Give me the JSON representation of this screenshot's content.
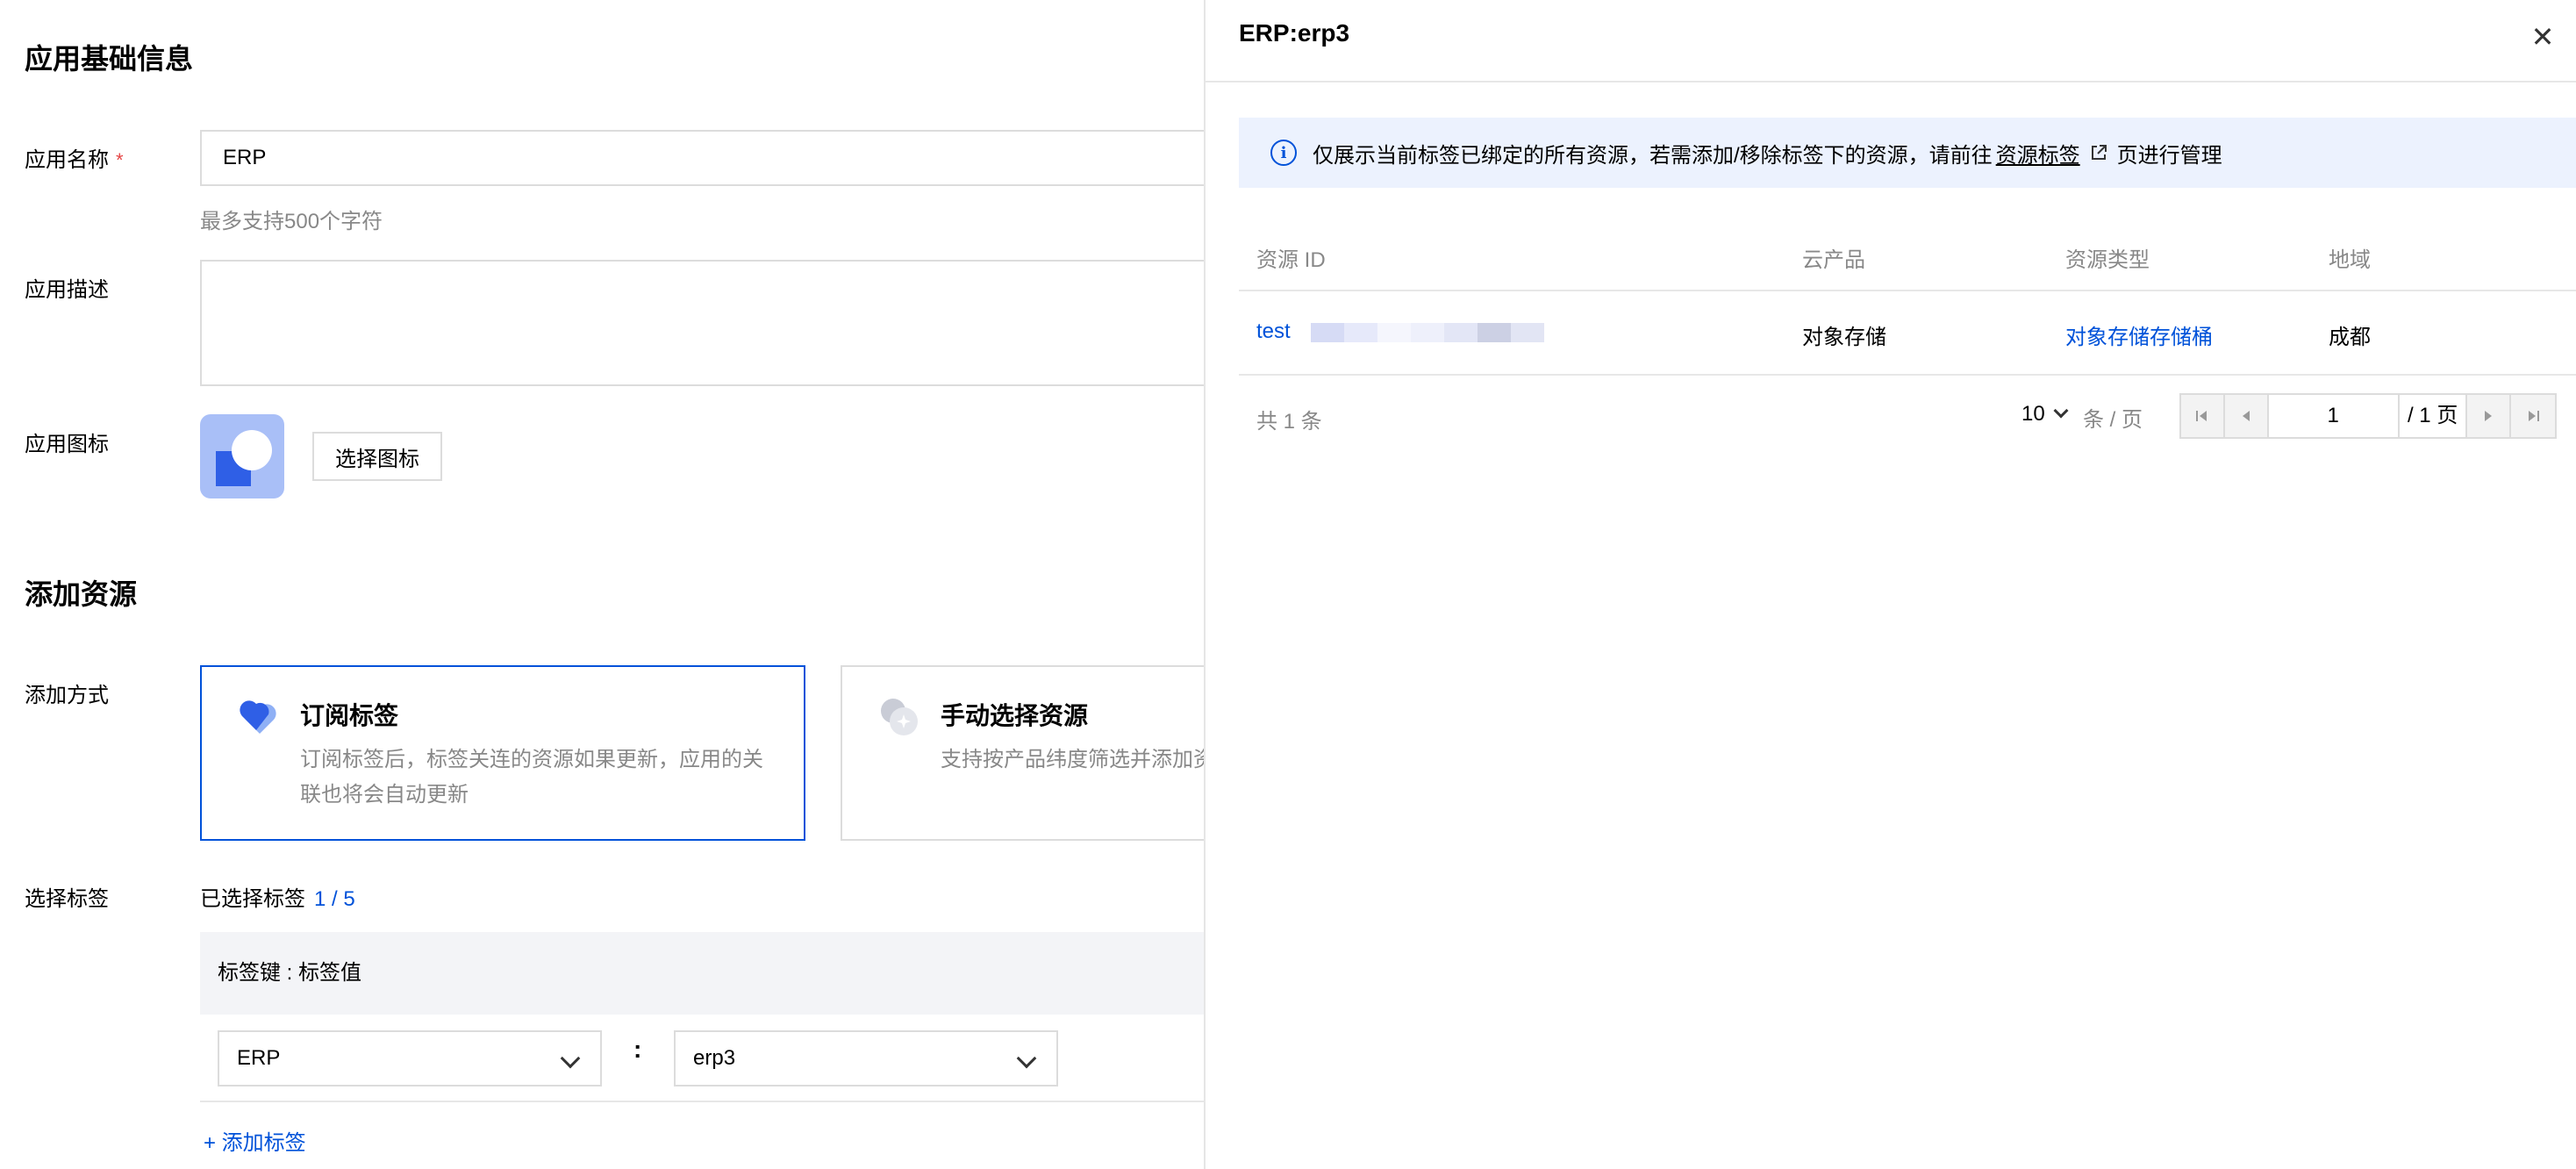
{
  "form": {
    "section_basic": "应用基础信息",
    "name_label": "应用名称",
    "required_mark": "*",
    "name_value": "ERP",
    "name_hint": "最多支持500个字符",
    "desc_label": "应用描述",
    "icon_label": "应用图标",
    "choose_icon_button": "选择图标",
    "section_resources": "添加资源",
    "method_label": "添加方式",
    "method_options": [
      {
        "title": "订阅标签",
        "desc_line1": "订阅标签后，标签关连的资源如果更新，应用的关",
        "desc_line2": "联也将会自动更新",
        "selected": true
      },
      {
        "title": "手动选择资源",
        "desc_line1": "支持按产品纬度筛选并添加资",
        "desc_line2": "",
        "selected": false
      }
    ],
    "tag_label": "选择标签",
    "selected_tags_text": "已选择标签",
    "selected_tags_count": "1 / 5",
    "tag_table_header": "标签键 : 标签值",
    "tag_key_value": "ERP",
    "tag_separator": ":",
    "tag_value_value": "erp3",
    "add_tag_button": "+ 添加标签"
  },
  "drawer": {
    "title": "ERP:erp3",
    "close_glyph": "✕",
    "alert_text": "仅展示当前标签已绑定的所有资源，若需添加/移除标签下的资源，请前往",
    "alert_link": "资源标签",
    "alert_suffix": "页进行管理",
    "columns": [
      "资源 ID",
      "云产品",
      "资源类型",
      "地域"
    ],
    "rows": [
      {
        "resource_id": "test",
        "product": "对象存储",
        "type": "对象存储存储桶",
        "region": "成都"
      }
    ],
    "total_text": "共 1 条",
    "page_size": "10",
    "page_size_unit": "条 / 页",
    "current_page": "1",
    "total_pages_text": "/ 1 页"
  },
  "colors": {
    "primary": "#0052d9",
    "required": "#e54545",
    "alert_bg": "#ecf2fe"
  },
  "icons": [
    "info-icon",
    "external-link-icon",
    "close-icon",
    "chevron-down-icon",
    "first-page-icon",
    "prev-page-icon",
    "next-page-icon",
    "last-page-icon"
  ]
}
